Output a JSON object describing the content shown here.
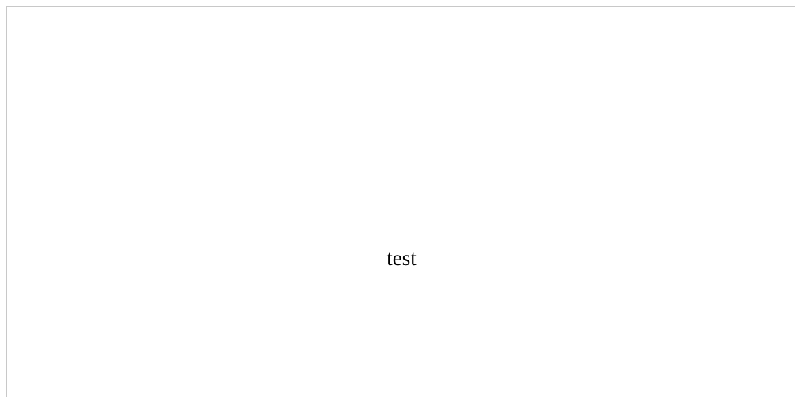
{
  "content": {
    "text": "test"
  }
}
